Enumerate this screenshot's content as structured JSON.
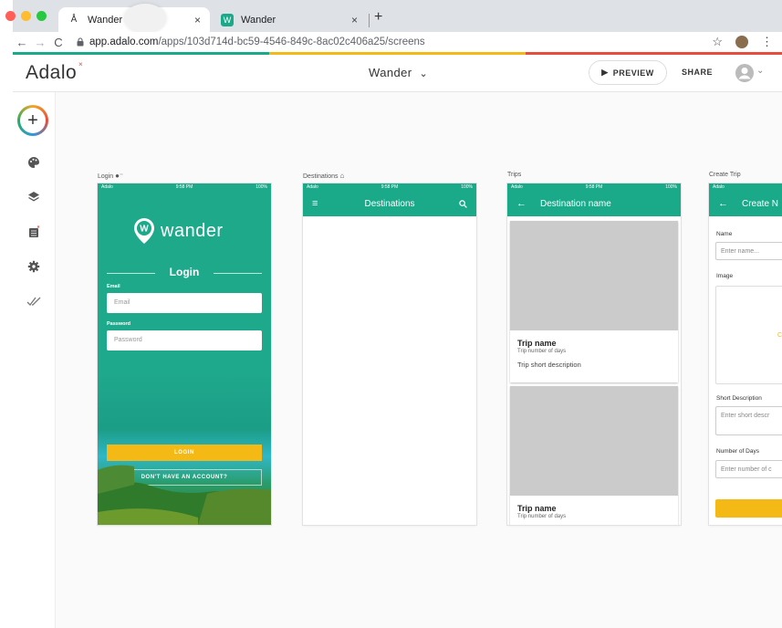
{
  "browser": {
    "tabs": [
      {
        "title": "Wander",
        "close": "×"
      },
      {
        "title": "Wander",
        "close": "×"
      }
    ],
    "new_tab": "+",
    "url_host": "app.adalo.com",
    "url_path": "/apps/103d714d-bc59-4546-849c-8ac02c406a25/screens",
    "star": "☆",
    "menu": "⋮",
    "traffic_colors": [
      "#ff5f57",
      "#febc2e",
      "#28c840"
    ],
    "strip_colors": [
      "#1aaa8a",
      "#f5b915",
      "#e74c3c"
    ]
  },
  "header": {
    "logo": "Adalo",
    "logo_mark": "×",
    "app_name": "Wander",
    "preview_label": "PREVIEW",
    "share_label": "SHARE"
  },
  "rail": {
    "add": "+"
  },
  "screens": {
    "login": {
      "label": "Login",
      "status_left": "Adalo",
      "status_time": "9:58 PM",
      "status_batt": "100%",
      "brand": "wander",
      "title": "Login",
      "email_label": "Email",
      "email_placeholder": "Email",
      "password_label": "Password",
      "password_placeholder": "Password",
      "login_button": "LOGIN",
      "signup_button": "DON'T HAVE AN ACCOUNT?"
    },
    "destinations": {
      "label": "Destinations",
      "status_left": "Adalo",
      "status_time": "9:58 PM",
      "status_batt": "100%",
      "title": "Destinations"
    },
    "trips": {
      "label": "Trips",
      "status_left": "Adalo",
      "status_time": "9:58 PM",
      "status_batt": "100%",
      "title": "Destination name",
      "cards": [
        {
          "name": "Trip name",
          "days": "Trip number of days",
          "desc": "Trip short description"
        },
        {
          "name": "Trip name",
          "days": "Trip number of days",
          "desc": ""
        }
      ],
      "fab": "+"
    },
    "create_trip": {
      "label": "Create Trip",
      "status_left": "Adalo",
      "title": "Create N",
      "name_label": "Name",
      "name_placeholder": "Enter name...",
      "image_label": "Image",
      "short_desc_label": "Short Description",
      "short_desc_placeholder": "Enter short descr",
      "days_label": "Number of Days",
      "days_placeholder": "Enter number of c"
    }
  },
  "colors": {
    "teal": "#1aaa8a",
    "yellow": "#f5b915"
  }
}
